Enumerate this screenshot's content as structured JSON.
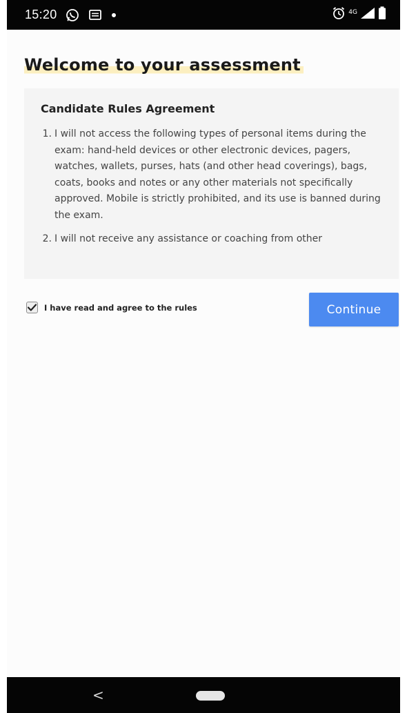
{
  "status_bar": {
    "time": "15:20",
    "icons_left": [
      "whatsapp-icon",
      "message-icon",
      "notification-dot-icon"
    ],
    "icons_right": [
      "alarm-icon",
      "data-signal-icon",
      "signal-icon",
      "battery-icon"
    ],
    "signal_label": "4G"
  },
  "page": {
    "title": "Welcome to your assessment",
    "highlight_color": "#fcefc0"
  },
  "rules": {
    "heading": "Candidate Rules Agreement",
    "items": [
      {
        "number": "1.",
        "text": "I will not access the following types of personal items during the exam: hand-held devices or other electronic devices, pagers, watches, wallets, purses, hats (and other head coverings), bags, coats, books and notes or any other materials not specifically approved. Mobile is strictly prohibited, and its use is banned during the exam."
      },
      {
        "number": "2.",
        "text": "I will not receive any assistance or coaching from other"
      }
    ]
  },
  "agreement": {
    "label": "I have read and agree to the rules",
    "checked": true
  },
  "actions": {
    "continue_label": "Continue",
    "continue_color": "#4c8af0"
  },
  "nav_bar": {
    "back_glyph": "<"
  }
}
